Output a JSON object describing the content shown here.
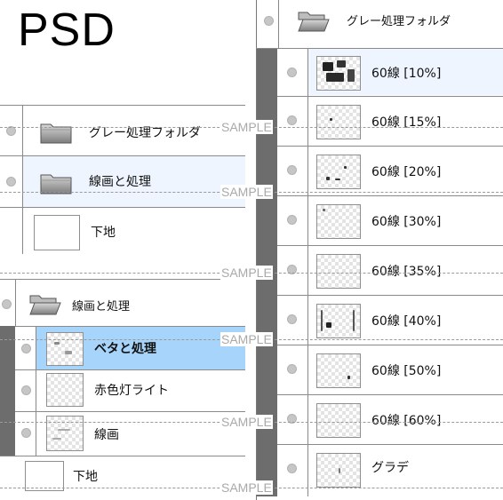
{
  "title": "PSD",
  "watermark": "SAMPLE",
  "panel1": {
    "rows": [
      {
        "label": "グレー処理フォルダ",
        "icon": "folder-icon"
      },
      {
        "label": "線画と処理",
        "icon": "folder-icon"
      },
      {
        "label": "下地",
        "icon": "blank-thumbnail"
      }
    ]
  },
  "panel2": {
    "rows": [
      {
        "label": "線画と処理",
        "icon": "folder-open-icon"
      },
      {
        "label": "ベタと処理",
        "selected": true
      },
      {
        "label": "赤色灯ライト"
      },
      {
        "label": "線画"
      },
      {
        "label": "下地",
        "icon": "blank-thumbnail"
      }
    ]
  },
  "panel3": {
    "rows": [
      {
        "label": "グレー処理フォルダ",
        "icon": "folder-open-icon"
      },
      {
        "label": "60線 [10%]"
      },
      {
        "label": "60線 [15%]"
      },
      {
        "label": "60線 [20%]"
      },
      {
        "label": "60線 [30%]"
      },
      {
        "label": "60線 [35%]"
      },
      {
        "label": "60線 [40%]"
      },
      {
        "label": "60線 [50%]"
      },
      {
        "label": "60線 [60%]"
      },
      {
        "label": "グラデ"
      }
    ]
  },
  "colors": {
    "selected_row": "#a7d4fa",
    "hover_row": "#eef5ff",
    "side_bar": "#6d6d6d",
    "line": "#8a8a8a"
  }
}
